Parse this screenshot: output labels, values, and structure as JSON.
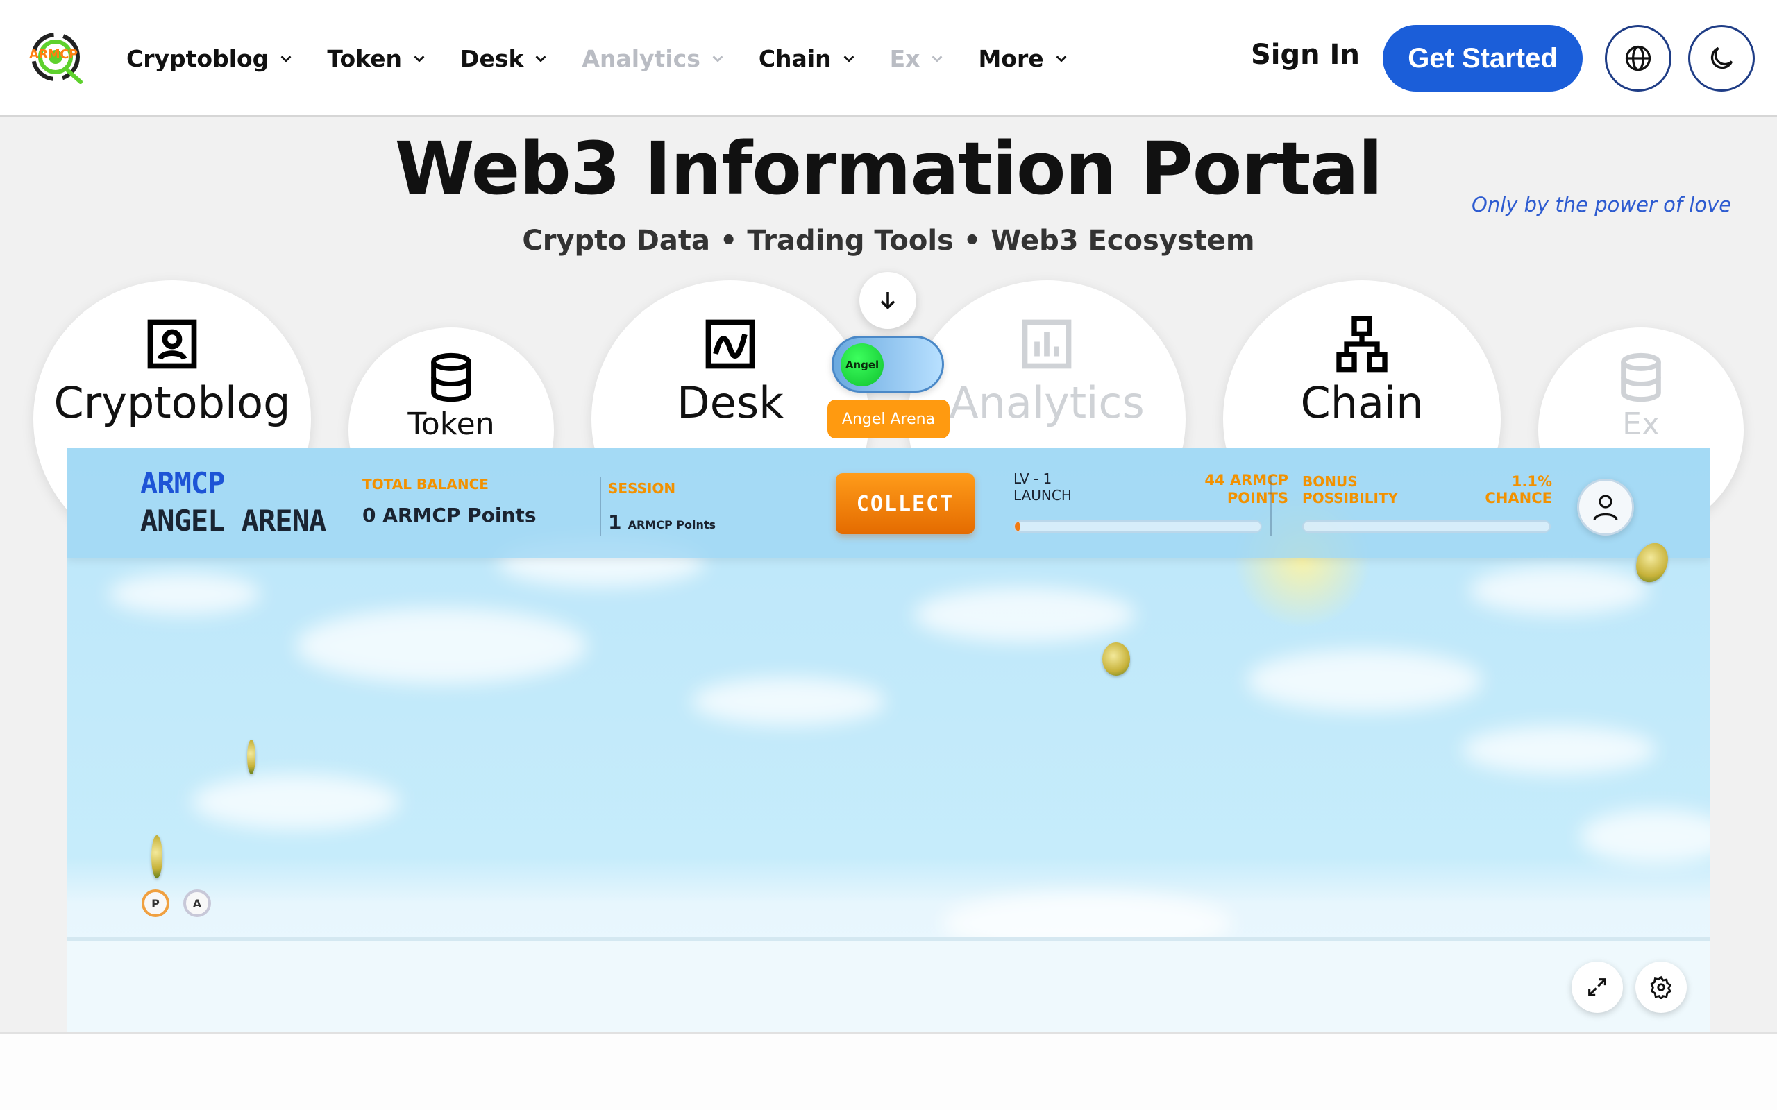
{
  "header": {
    "logo_text": "ARMCP",
    "nav": [
      {
        "label": "Cryptoblog",
        "muted": false
      },
      {
        "label": "Token",
        "muted": false
      },
      {
        "label": "Desk",
        "muted": false
      },
      {
        "label": "Analytics",
        "muted": true
      },
      {
        "label": "Chain",
        "muted": false
      },
      {
        "label": "Ex",
        "muted": true
      },
      {
        "label": "More",
        "muted": false
      }
    ],
    "sign_in": "Sign In",
    "get_started": "Get Started",
    "language_icon": "globe-icon",
    "theme_icon": "moon-icon",
    "brand_color": "#1b5ed9"
  },
  "hero": {
    "title": "Web3 Information Portal",
    "subtitle": "Crypto Data • Trading Tools • Web3 Ecosystem",
    "tagline": "Only by the power of love",
    "sections": [
      {
        "label": "Cryptoblog",
        "icon": "portrait-icon"
      },
      {
        "label": "Token",
        "icon": "database-icon"
      },
      {
        "label": "Desk",
        "icon": "line-chart-icon"
      },
      {
        "label": "Analytics",
        "icon": "bar-chart-icon"
      },
      {
        "label": "Chain",
        "icon": "hierarchy-icon"
      },
      {
        "label": "Ex",
        "icon": "database-icon"
      }
    ]
  },
  "angel_toggle": {
    "knob_label": "Angel",
    "pill_label": "Angel Arena",
    "accent": "#ff9a10"
  },
  "game": {
    "brand_line1": "ARMCP",
    "brand_line2": "ANGEL ARENA",
    "total_balance_label": "TOTAL BALANCE",
    "total_balance_value": "0 ARMCP Points",
    "session_label": "SESSION",
    "session_value": "1",
    "session_unit": "ARMCP Points",
    "collect_label": "COLLECT",
    "level_line1": "LV - 1",
    "level_line2": "LAUNCH",
    "level_points_line1": "44 ARMCP",
    "level_points_line2": "POINTS",
    "level_progress": 0.02,
    "bonus_line1": "BONUS",
    "bonus_line2": "POSSIBILITY",
    "bonus_chance": "1.1% CHANCE",
    "bonus_progress": 0.0,
    "player_badges": [
      "P",
      "A"
    ],
    "accent_orange": "#f29100"
  }
}
